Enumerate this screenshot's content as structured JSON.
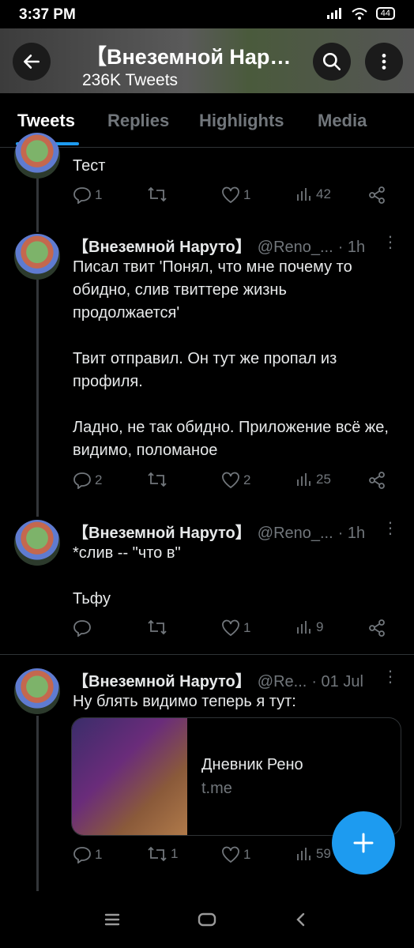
{
  "status_bar": {
    "time": "3:37 PM",
    "battery": "44"
  },
  "header": {
    "title": "【Внеземной Нар…",
    "subtitle": "236K Tweets"
  },
  "tabs": [
    {
      "label": "Tweets",
      "active": true
    },
    {
      "label": "Replies",
      "active": false
    },
    {
      "label": "Highlights",
      "active": false
    },
    {
      "label": "Media",
      "active": false
    }
  ],
  "tweets": [
    {
      "text": "Тест",
      "replies": "1",
      "retweets": "",
      "likes": "1",
      "views": "42"
    },
    {
      "name": "【Внеземной Наруто】",
      "handle": "@Reno_...",
      "time": "· 1h",
      "text": "Писал твит 'Понял, что мне почему то обидно, слив твиттере жизнь продолжается'\n\nТвит отправил. Он тут же пропал из профиля.\n\nЛадно, не так обидно. Приложение всё же, видимо, поломаное",
      "replies": "2",
      "retweets": "",
      "likes": "2",
      "views": "25"
    },
    {
      "name": "【Внеземной Наруто】",
      "handle": "@Reno_...",
      "time": "· 1h",
      "text": "*слив -- \"что в\"\n\nТьфу",
      "replies": "",
      "retweets": "",
      "likes": "1",
      "views": "9"
    },
    {
      "name": "【Внеземной Наруто】",
      "handle": "@Re...",
      "time": "· 01 Jul",
      "text": "Ну блять видимо теперь я тут:",
      "card": {
        "title": "Дневник Рено",
        "domain": "t.me"
      },
      "replies": "1",
      "retweets": "1",
      "likes": "1",
      "views": "59"
    }
  ],
  "colors": {
    "accent": "#1d9bf0",
    "muted": "#71767b",
    "background": "#000000"
  }
}
